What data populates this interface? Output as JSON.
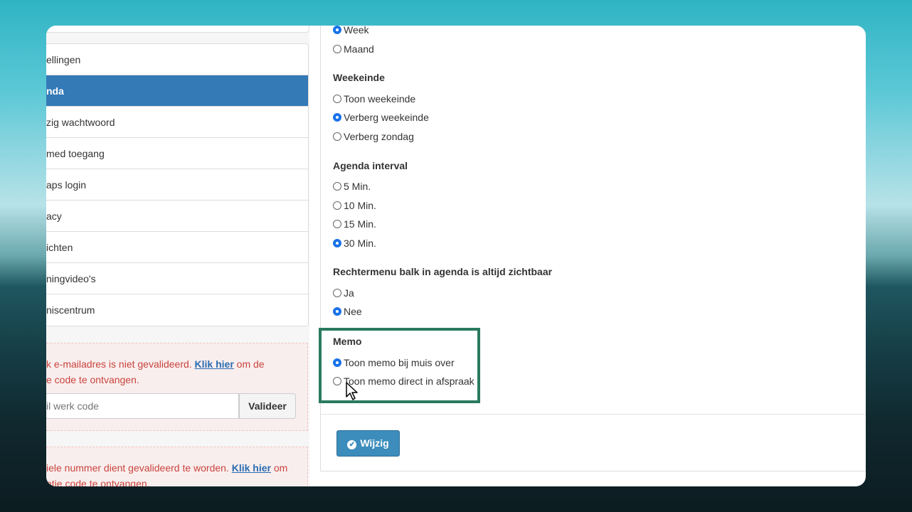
{
  "menu": {
    "items": [
      {
        "label": "ellingen",
        "active": false
      },
      {
        "label": "nda",
        "active": true
      },
      {
        "label": "zig wachtwoord",
        "active": false
      },
      {
        "label": "med toegang",
        "active": false
      },
      {
        "label": "aps login",
        "active": false
      },
      {
        "label": "acy",
        "active": false
      },
      {
        "label": "ichten",
        "active": false
      },
      {
        "label": "ningvideo's",
        "active": false
      },
      {
        "label": "niscentrum",
        "active": false
      }
    ]
  },
  "email_alert": {
    "text_before": "k e-mailadres is niet gevalideerd. ",
    "link": "Klik hier",
    "text_after": " om de",
    "line2": "e code te ontvangen.",
    "input_placeholder": "il werk code",
    "button_label": "Valideer"
  },
  "phone_alert": {
    "text_before": "iele nummer dient gevalideerd te worden. ",
    "link": "Klik hier",
    "text_after": " om",
    "line2": "atie code te ontvangen."
  },
  "view_options": {
    "week": "Week",
    "month": "Maand",
    "selected": "week"
  },
  "weekend": {
    "title": "Weekeinde",
    "options": [
      "Toon weekeinde",
      "Verberg weekeinde",
      "Verberg zondag"
    ],
    "selected_index": 1
  },
  "interval": {
    "title": "Agenda interval",
    "options": [
      "5 Min.",
      "10 Min.",
      "15 Min.",
      "30 Min."
    ],
    "selected_index": 3
  },
  "right_menu": {
    "title": "Rechtermenu balk in agenda is altijd zichtbaar",
    "options": [
      "Ja",
      "Nee"
    ],
    "selected_index": 1
  },
  "memo": {
    "title": "Memo",
    "options": [
      "Toon memo bij muis over",
      "Toon memo direct in afspraak"
    ],
    "selected_index": 0
  },
  "submit": {
    "label": "Wijzig",
    "icon": "check-circle-icon"
  },
  "colors": {
    "active_menu": "#337ab7",
    "alert_text": "#c9443c",
    "radio_selected": "#1a73e8",
    "highlight_border": "#2a7a5f",
    "submit_bg": "#3c8dbc"
  }
}
